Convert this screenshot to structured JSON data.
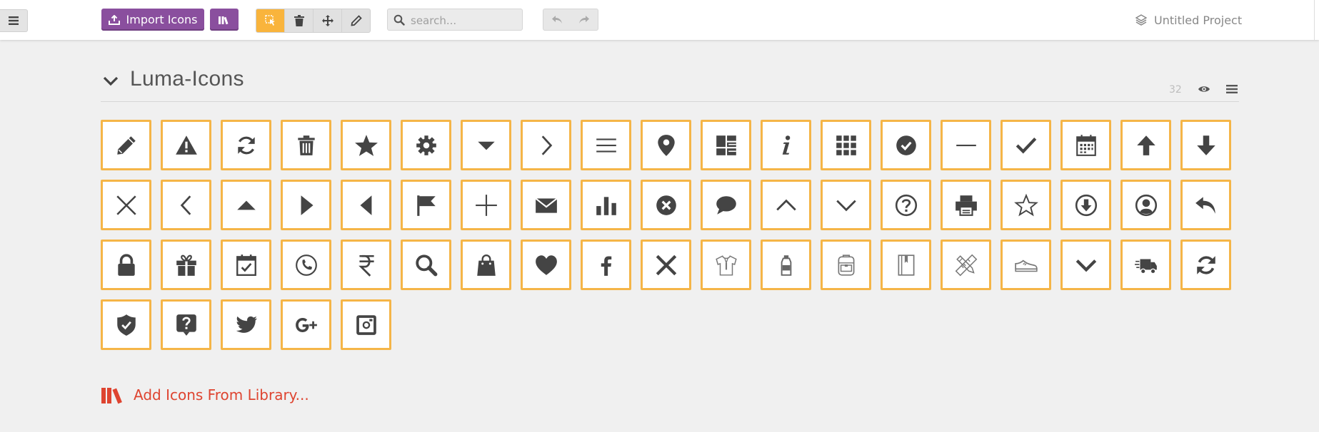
{
  "toolbar": {
    "import_label": "Import Icons",
    "search_placeholder": "search...",
    "project_title": "Untitled Project"
  },
  "set": {
    "title": "Luma-Icons",
    "count": "32"
  },
  "icons": [
    "pencil-icon",
    "warning-icon",
    "refresh-icon",
    "trash-icon",
    "star-filled-icon",
    "gear-icon",
    "caret-down-icon",
    "chevron-right-icon",
    "menu-icon",
    "map-pin-icon",
    "dashboard-icon",
    "info-icon",
    "apps-grid-icon",
    "check-circle-icon",
    "minus-icon",
    "check-icon",
    "calendar-icon",
    "arrow-up-icon",
    "arrow-down-icon",
    "close-icon",
    "chevron-left-icon",
    "caret-up-icon",
    "play-icon",
    "caret-left-icon",
    "flag-icon",
    "plus-icon",
    "mail-icon",
    "bar-chart-icon",
    "x-circle-icon",
    "chat-bubble-icon",
    "chevron-up-icon",
    "chevron-down-icon",
    "help-circle-icon",
    "printer-icon",
    "star-outline-icon",
    "download-circle-icon",
    "user-circle-icon",
    "reply-icon",
    "lock-icon",
    "gift-icon",
    "calendar-check-icon",
    "phone-circle-icon",
    "rupee-icon",
    "search-icon",
    "shopping-bag-icon",
    "heart-icon",
    "facebook-icon",
    "close-bold-icon",
    "shirt-icon",
    "bottle-icon",
    "backpack-icon",
    "book-icon",
    "pencil-ruler-icon",
    "sneaker-icon",
    "chevron-down-bold-icon",
    "delivery-truck-icon",
    "sync-icon",
    "shield-check-icon",
    "question-bubble-icon",
    "twitter-icon",
    "google-plus-icon",
    "instagram-icon"
  ],
  "footer": {
    "add_library_label": "Add Icons From Library..."
  }
}
